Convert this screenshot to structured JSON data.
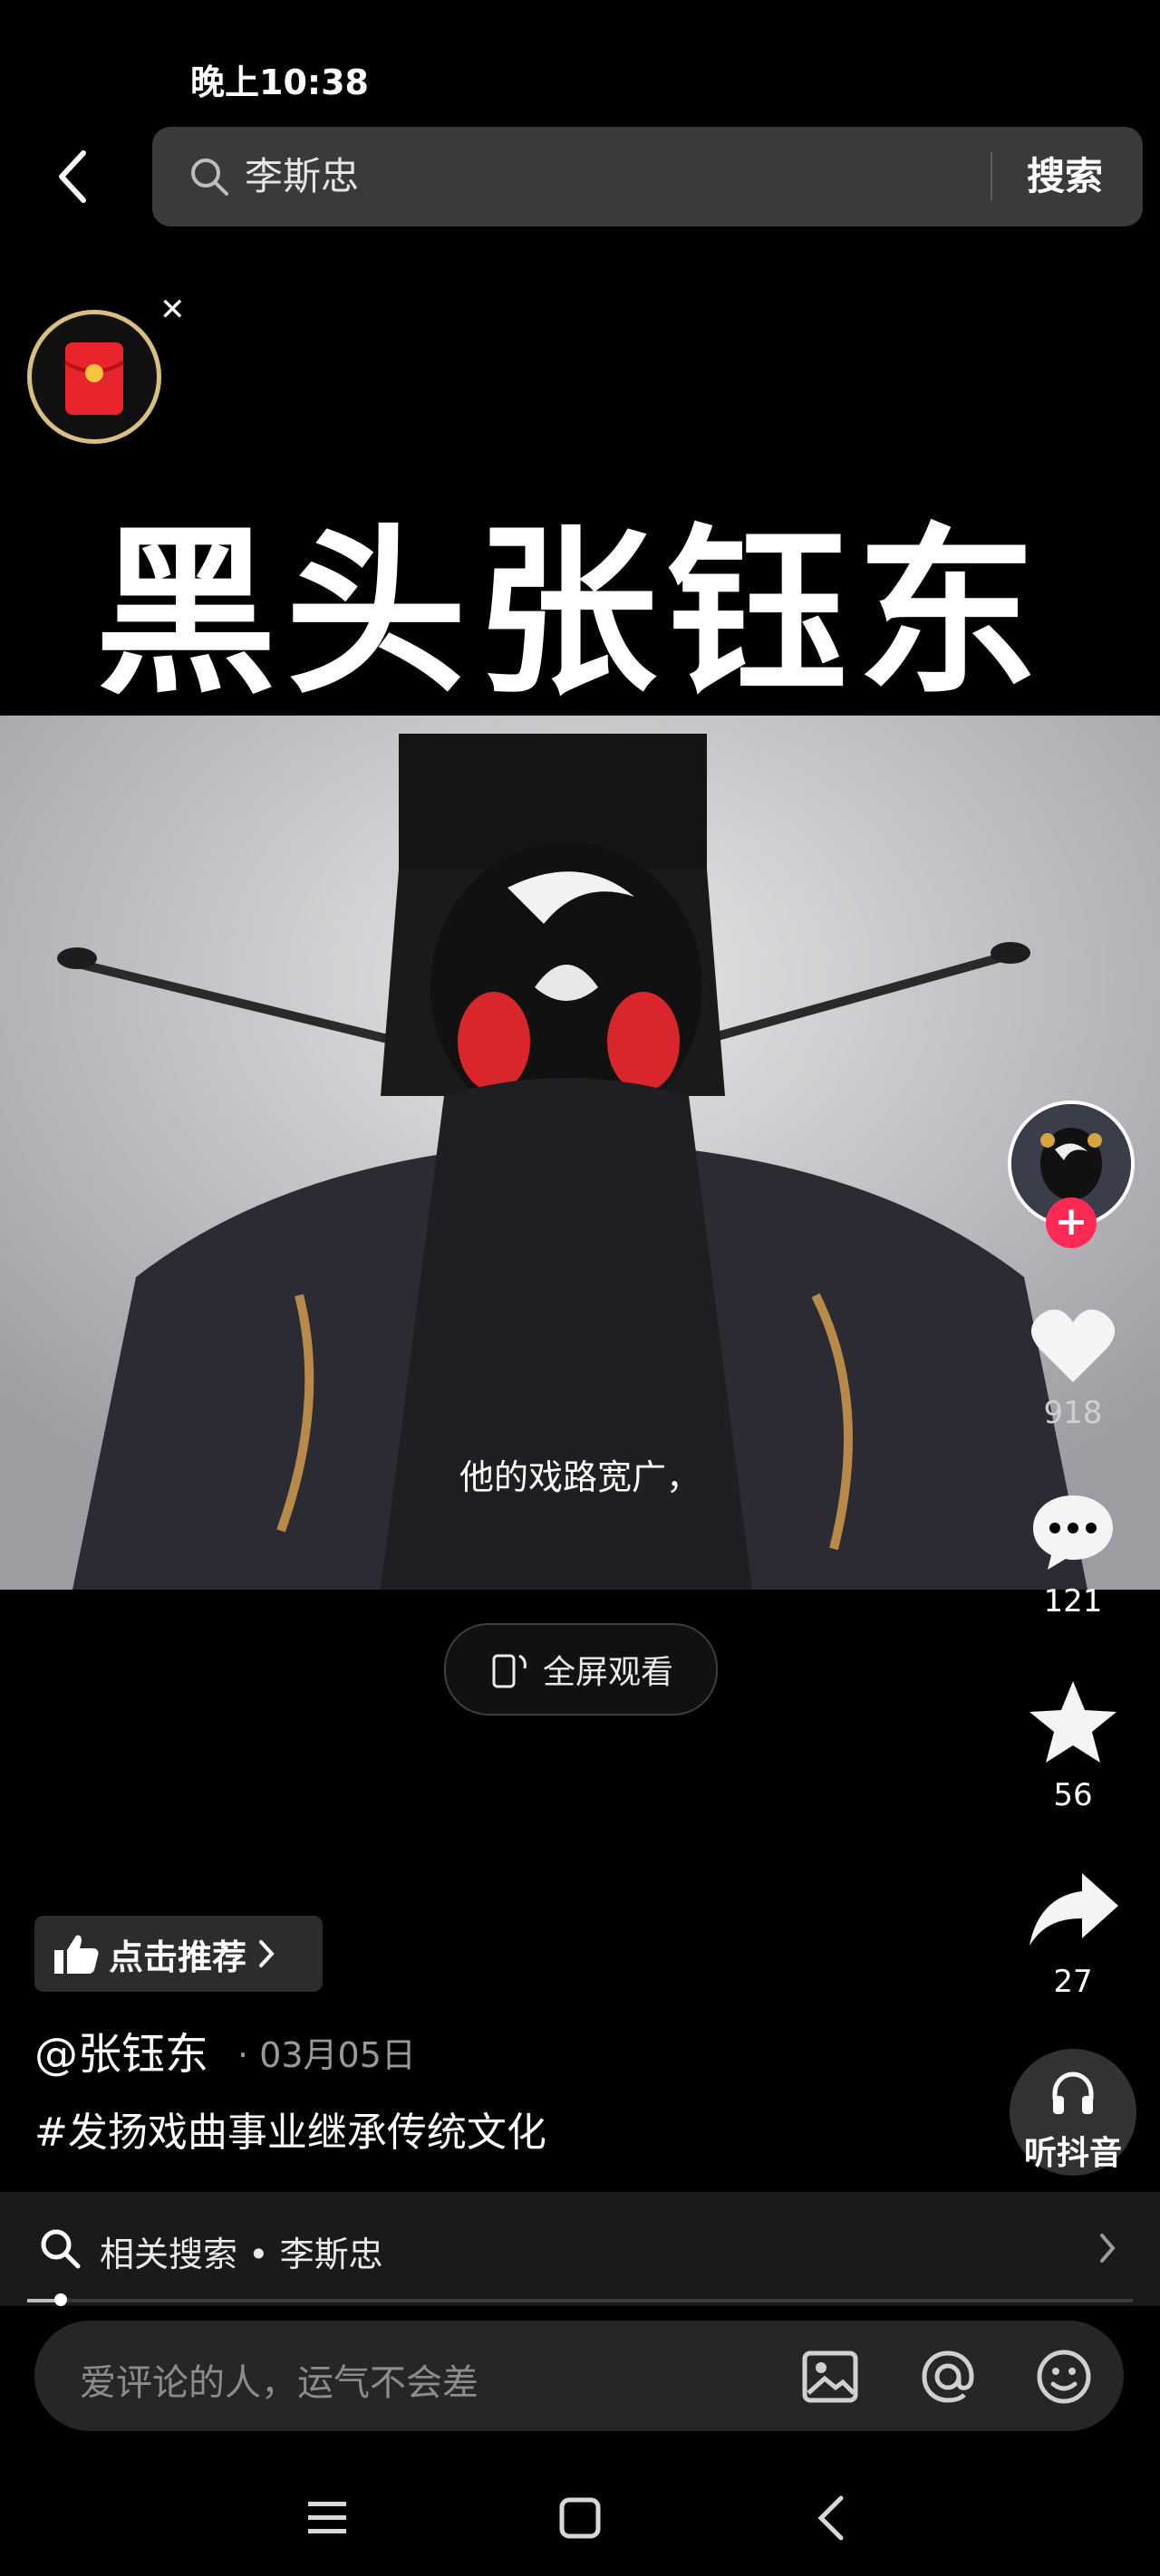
{
  "status_bar": {
    "time": "晚上10:38"
  },
  "search": {
    "query": "李斯忠",
    "button_label": "搜索"
  },
  "video": {
    "headline": "黑头张钰东",
    "subtitle": "他的戏路宽广，",
    "fullscreen_label": "全屏观看"
  },
  "actions": {
    "likes": "918",
    "comments": "121",
    "favorites": "56",
    "shares": "27",
    "listen_label": "听抖音"
  },
  "post": {
    "recommend_label": "点击推荐",
    "author": "@张钰东",
    "date": "· 03月05日",
    "hashtag": "#发扬戏曲事业继承传统文化"
  },
  "related_search": {
    "label": "相关搜索 • 李斯忠"
  },
  "playback": {
    "progress": 0.03
  },
  "comment": {
    "placeholder": "爱评论的人，运气不会差"
  },
  "colors": {
    "accent": "#ff2b55",
    "background": "#000000"
  }
}
